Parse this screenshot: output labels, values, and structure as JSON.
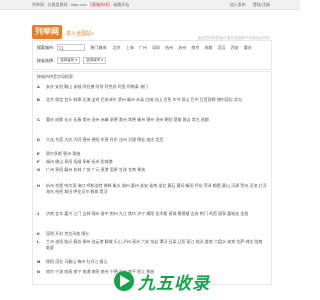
{
  "topbar": {
    "left_prefix": "列举网 · 分类信息网 · lieju.com",
    "left_highlight": "【客服热线】",
    "left_suffix": "诚邀开站",
    "login": "加入发布",
    "reg": "登陆/注册"
  },
  "header": {
    "logo": "列举网",
    "slogan": "进入全国站>",
    "site_desc": "免费发布信息网站·服务全国城市·找到适合你的"
  },
  "search": {
    "label": "搜索城市:",
    "placeholder": "",
    "hot_label": "热门城市:",
    "hot_cities": [
      "北京",
      "上海",
      "广州",
      "深圳",
      "杭州",
      "苏州",
      "南京",
      "成都",
      "武汉",
      "西安",
      "重庆"
    ]
  },
  "filter": {
    "label": "按省选择:",
    "province": "选择省份",
    "city": "选择城市"
  },
  "list": {
    "title": "按城市拼音字母检索:",
    "groups": [
      {
        "letter": "A",
        "cities": "安庆 安阳 鞍山 安顺 阿拉善 阿坝 阿克苏 阿里 阿勒泰 澳门"
      },
      {
        "letter": "B",
        "cities": "北京 保定 包头 蚌埠 北海 宝鸡 巴彦淖尔 滨州 亳州 本溪 白城 白山 百色 毕节 保山 巴中 巴音郭楞 博尔塔拉 北屯"
      },
      {
        "letter": "C",
        "cities": "重庆 成都 长沙 长春 常州 沧州 赤峰 承德 滁州 常德 郴州 潮州 池州 朝阳 楚雄 昌吉 崇左 昌都"
      },
      {
        "letter": "D",
        "cities": "大连 东莞 大庆 大同 德州 德阳 东营 丹东 达州 大理 德宏 迪庆 定西"
      },
      {
        "letter": "E",
        "cities": "鄂尔多斯 鄂州 恩施"
      },
      {
        "letter": "F",
        "cities": "福州 佛山 阜阳 抚顺 阜新 抚州 防城港"
      },
      {
        "letter": "G",
        "cities": "广州 贵阳 赣州 桂林 广安 广元 贵港 固原 甘孜 甘南 果洛"
      },
      {
        "letter": "H",
        "cities": "杭州 合肥 哈尔滨 海口 呼和浩特 邯郸 衡水 湖州 惠州 淮安 淮南 淮北 黄石 黄冈 衡阳 怀化 菏泽 鹤壁 黄山 河源 贺州 河池 红河 海东 哈密 和田 呼伦贝尔 鹤岗 黑河"
      },
      {
        "letter": "J",
        "cities": "济南 金华 嘉兴 江门 吉林 锦州 晋中 荆州 九江 焦作 济宁 揭阳 佳木斯 晋城 景德镇 吉安 荆门 鸡西 酒泉 嘉峪关 金昌"
      },
      {
        "letter": "K",
        "cities": "昆明 开封 克拉玛依 喀什"
      },
      {
        "letter": "L",
        "cities": "兰州 洛阳 临沂 廊坊 柳州 连云港 聊城 乐山 泸州 丽水 六安 龙岩 漯河 吕梁 辽阳 丽江 临汾 娄底 六盘水 来宾 拉萨 林芝 陇南 临夏"
      },
      {
        "letter": "M",
        "cities": "绵阳 茂名 马鞍山 梅州 牡丹江 眉山"
      },
      {
        "letter": "N",
        "cities": "南京 宁波 南昌 南宁 南通 南阳 南充 宁德 内江 南平 怒江 那曲"
      }
    ]
  },
  "watermark": {
    "text": "九五收录"
  },
  "colors": {
    "brand": "#f47a20",
    "accent": "#e4393c",
    "watermark": "#14a54b"
  }
}
